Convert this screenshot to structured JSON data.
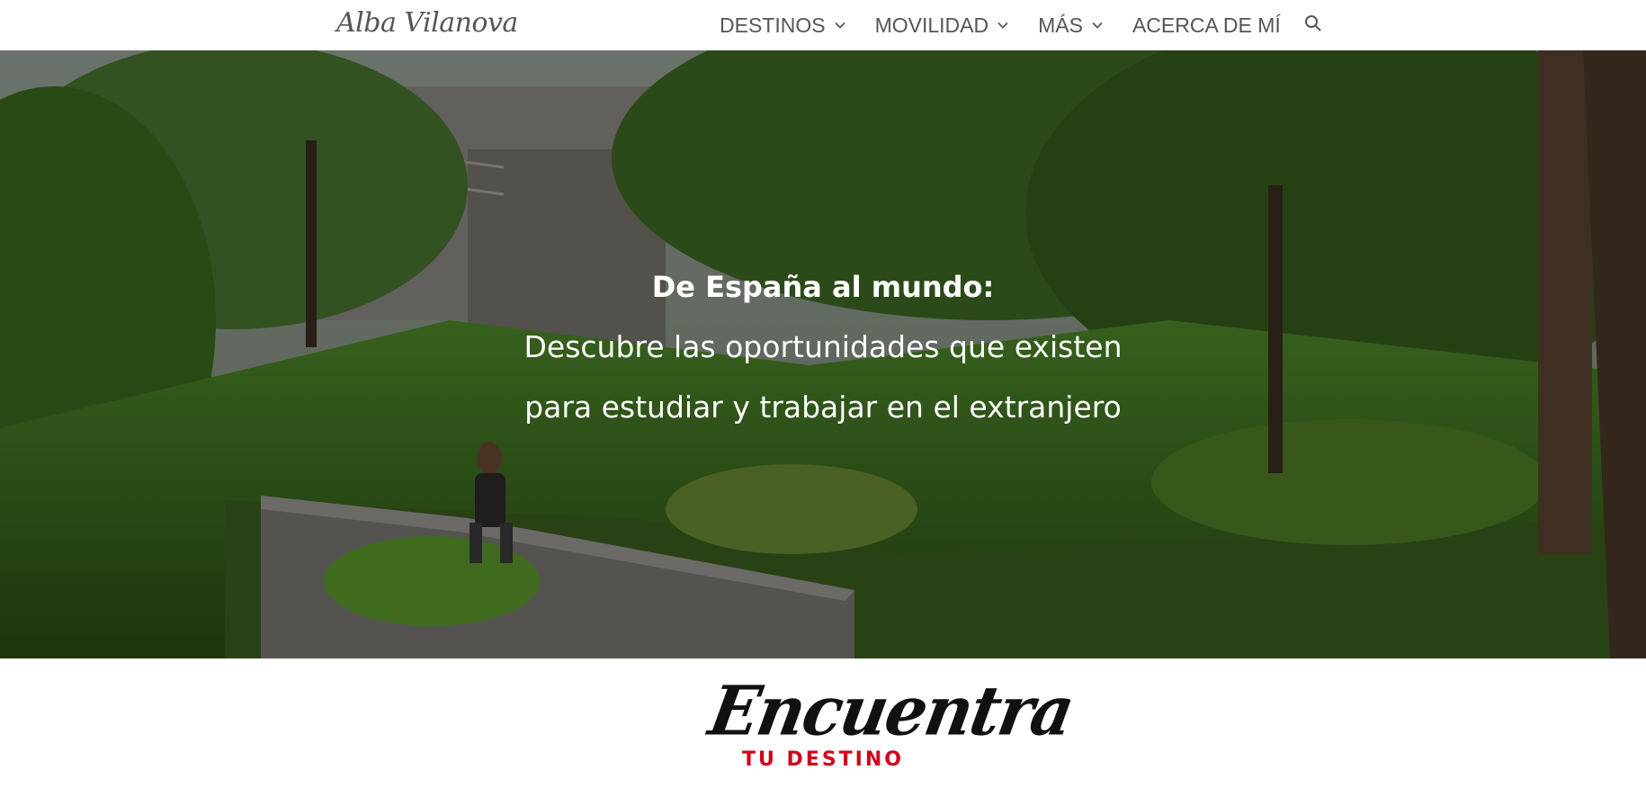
{
  "brand": {
    "name": "Alba Vilanova"
  },
  "nav": {
    "items": [
      {
        "label": "DESTINOS",
        "has_dropdown": true
      },
      {
        "label": "MOVILIDAD",
        "has_dropdown": true
      },
      {
        "label": "MÁS",
        "has_dropdown": true
      },
      {
        "label": "ACERCA DE MÍ",
        "has_dropdown": false
      }
    ],
    "search_icon": "search-icon",
    "dropdown_icon": "chevron-down-icon"
  },
  "hero": {
    "heading": "De España al mundo:",
    "line1": "Descubre las oportunidades que existen",
    "line2": "para estudiar y trabajar en el extranjero"
  },
  "section": {
    "script_title": "Encuentra",
    "subtitle": "TU DESTINO"
  },
  "colors": {
    "nav_text": "#555555",
    "accent_red": "#d0021b",
    "hero_text": "#ffffff"
  }
}
